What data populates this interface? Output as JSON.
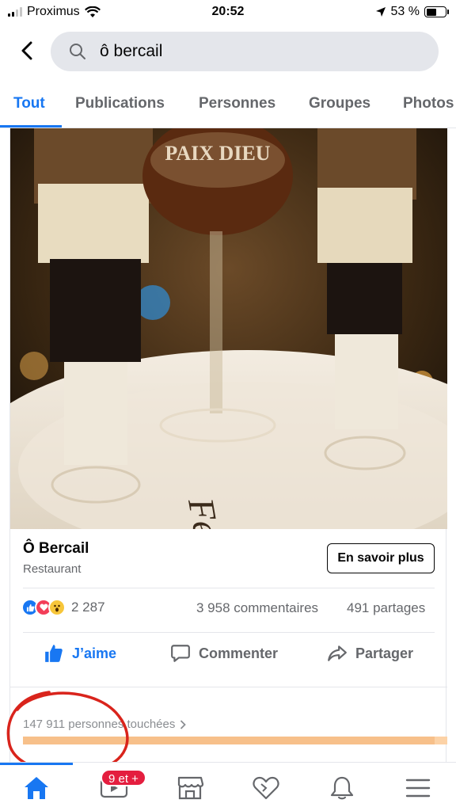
{
  "status_bar": {
    "carrier": "Proximus",
    "time": "20:52",
    "battery": "53 %",
    "battery_level": 0.53,
    "signal_bars": 2
  },
  "search": {
    "query": "ô bercail",
    "icons": [
      "back-arrow-icon",
      "search-icon"
    ]
  },
  "tabs": [
    {
      "label": "Tout",
      "active": true
    },
    {
      "label": "Publications",
      "active": false
    },
    {
      "label": "Personnes",
      "active": false
    },
    {
      "label": "Groupes",
      "active": false
    },
    {
      "label": "Photos",
      "active": false
    }
  ],
  "post": {
    "photo_text": "PAIX DIEU",
    "page_name": "Ô Bercail",
    "category": "Restaurant",
    "cta_label": "En savoir plus",
    "reactions_count": "2 287",
    "reactions": [
      "like",
      "love",
      "wow"
    ],
    "comments": "3 958 commentaires",
    "shares": "491 partages",
    "actions": {
      "like": "J’aime",
      "comment": "Commenter",
      "share": "Partager"
    },
    "reach_text": "147 911 personnes touchées",
    "reach_fill": 0.97
  },
  "bottom_nav": {
    "badge": "9 et +",
    "items": [
      "home-icon",
      "video-icon",
      "marketplace-icon",
      "dating-heart-icon",
      "notifications-bell-icon",
      "menu-icon"
    ]
  },
  "colors": {
    "accent": "#1877f2",
    "badge": "#e41e3f",
    "annotation": "#d9241c"
  }
}
